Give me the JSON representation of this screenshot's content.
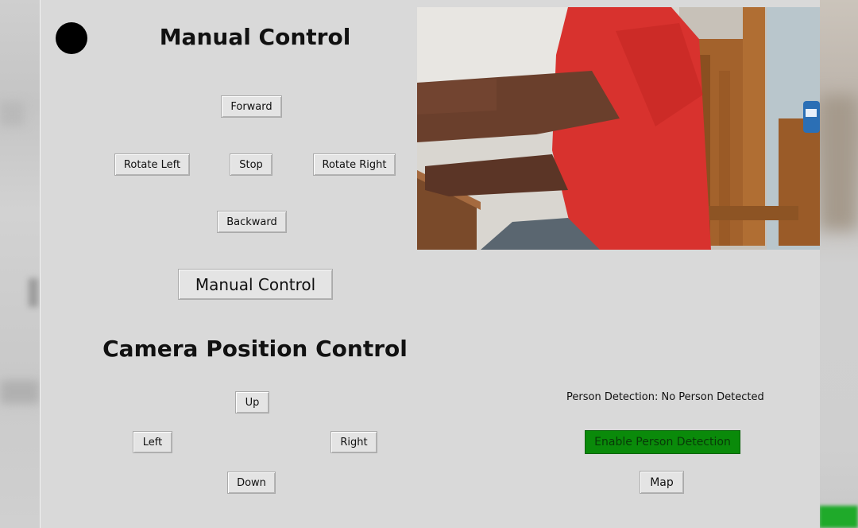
{
  "manual": {
    "title": "Manual Control",
    "forward_label": "Forward",
    "rotate_left_label": "Rotate Left",
    "stop_label": "Stop",
    "rotate_right_label": "Rotate Right",
    "backward_label": "Backward",
    "mode_button_label": "Manual Control"
  },
  "camera_control": {
    "title": "Camera Position Control",
    "up_label": "Up",
    "left_label": "Left",
    "right_label": "Right",
    "down_label": "Down"
  },
  "detection": {
    "status_text": "Person Detection: No Person Detected",
    "enable_label": "Enable Person Detection",
    "enable_color": "#0a8a0a"
  },
  "map_label": "Map",
  "icons": {
    "status_indicator": "status-dot-icon"
  }
}
